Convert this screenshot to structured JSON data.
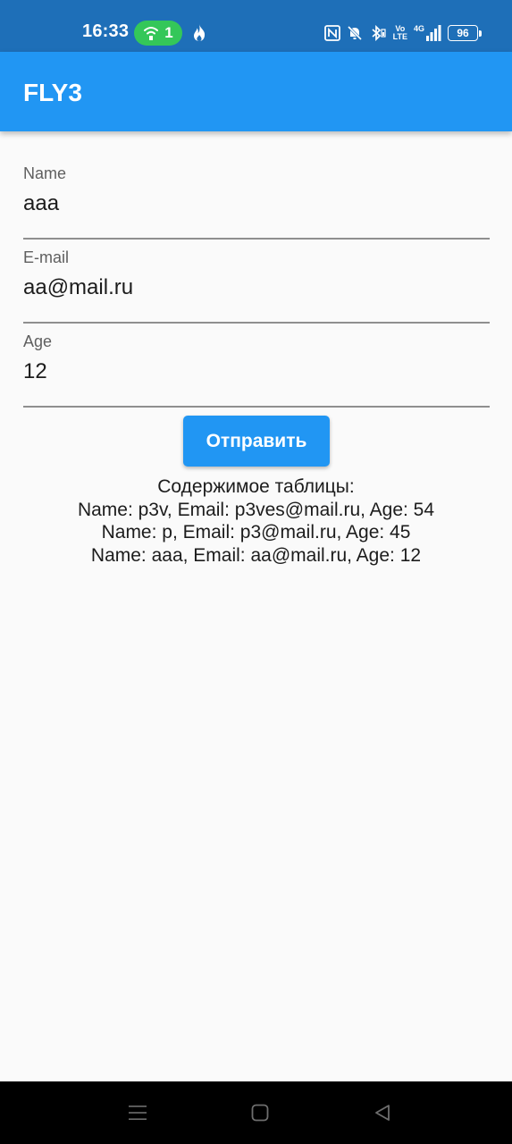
{
  "status_bar": {
    "time": "16:33",
    "hotspot_count": "1",
    "network_label_top": "Vo",
    "network_label_bottom": "LTE",
    "network_type": "4G",
    "battery_level": "96"
  },
  "app_bar": {
    "title": "FLY3"
  },
  "form": {
    "name": {
      "label": "Name",
      "value": "aaa"
    },
    "email": {
      "label": "E-mail",
      "value": "aa@mail.ru"
    },
    "age": {
      "label": "Age",
      "value": "12"
    },
    "submit_label": "Отправить"
  },
  "table": {
    "heading": "Содержимое таблицы:",
    "rows": [
      "Name: p3v, Email: p3ves@mail.ru, Age: 54",
      "Name: p, Email: p3@mail.ru, Age: 45",
      "Name: aaa, Email: aa@mail.ru, Age: 12"
    ]
  },
  "colors": {
    "status_bar": "#1e6fb8",
    "app_bar": "#2196f3",
    "button": "#2196f3",
    "hotspot_pill": "#34c759",
    "background": "#fafafa"
  },
  "icons": {
    "hotspot": "wifi-hotspot-icon",
    "flame": "flame-icon",
    "nfc": "nfc-icon",
    "mute": "bell-off-icon",
    "bluetooth": "bluetooth-icon",
    "signal": "signal-bars-icon",
    "nav_menu": "menu-icon",
    "nav_home": "home-square-icon",
    "nav_back": "back-triangle-icon"
  }
}
